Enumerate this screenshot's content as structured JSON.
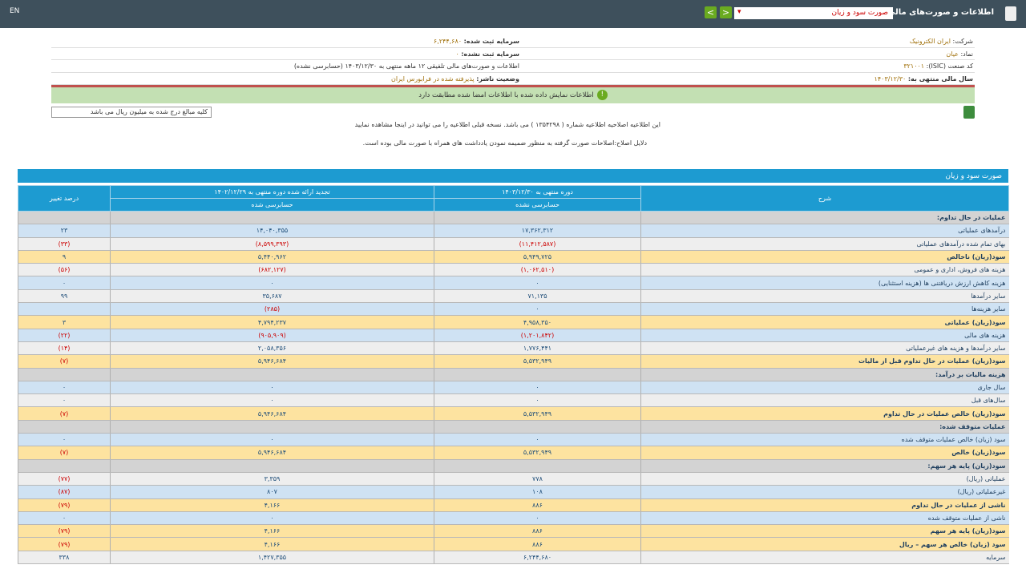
{
  "topbar": {
    "lang": "EN",
    "title": "اطلاعات و صورت‌های مالی تلفیقی",
    "select": "صورت سود و زیان",
    "prev": "<",
    "next": ">"
  },
  "info": {
    "company_label": "شرکت:",
    "company": "ایران الکترونیک",
    "symbol_label": "نماد:",
    "symbol": "عیان",
    "isic_label": "کد صنعت (ISIC):",
    "isic": "۳۲۱۰۰۱",
    "fy_label": "سال مالی منتهی به:",
    "fy": "۱۴۰۳/۱۲/۳۰",
    "cap_label": "سرمایه ثبت شده:",
    "cap": "۶,۲۴۴,۶۸۰",
    "uncap_label": "سرمایه ثبت نشده:",
    "uncap": "۰",
    "report": "اطلاعات و صورت‌های مالی تلفیقی ۱۲ ماهه منتهی به ۱۴۰۳/۱۲/۳۰ (حسابرسی نشده)",
    "status_label": "وضعیت ناشر:",
    "status": "پذیرفته شده در فرابورس ایران",
    "match": "اطلاعات نمایش داده شده با اطلاعات امضا شده مطابقت دارد"
  },
  "unit": "کلیه مبالغ درج شده به میلیون ریال می باشد",
  "notice1": "این اطلاعیه اصلاحیه اطلاعیه شماره ( ۱۳۵۴۲۹۸ ) می باشد. نسخه قبلی اطلاعیه را می توانید در اینجا مشاهده نمایید",
  "notice2": "دلایل اصلاح:اصلاحات صورت گرفته به منظور ضمیمه نمودن یادداشت های همراه با صورت مالی بوده است.",
  "table": {
    "caption": "صورت سود و زیان",
    "h_desc": "شرح",
    "h_cur": "دوره منتهی به ۱۴۰۳/۱۲/۳۰",
    "h_cur_sub": "حسابرسی نشده",
    "h_prev": "تجدید ارائه شده دوره منتهی به ۱۴۰۲/۱۲/۲۹",
    "h_prev_sub": "حسابرسی شده",
    "h_pct": "درصد تغییر",
    "rows": [
      {
        "t": "sec",
        "label": "عملیات در حال تداوم:",
        "cur": "",
        "prev": "",
        "pct": ""
      },
      {
        "t": "blue",
        "label": "درآمدهای عملیاتی",
        "cur": "۱۷,۳۶۲,۳۱۲",
        "prev": "۱۴,۰۴۰,۳۵۵",
        "pct": "۲۳"
      },
      {
        "t": "light",
        "label": "بهای تمام شده درآمدهای عملیاتی",
        "cur": "(۱۱,۴۱۲,۵۸۷)",
        "prev": "(۸,۵۹۹,۳۹۳)",
        "pct": "(۳۳)"
      },
      {
        "t": "yel",
        "label": "سود(زیان) ناخالص",
        "cur": "۵,۹۴۹,۷۲۵",
        "prev": "۵,۴۴۰,۹۶۲",
        "pct": "۹"
      },
      {
        "t": "light",
        "label": "هزینه های فروش، اداری و عمومی",
        "cur": "(۱,۰۶۲,۵۱۰)",
        "prev": "(۶۸۲,۱۲۷)",
        "pct": "(۵۶)"
      },
      {
        "t": "blue",
        "label": "هزینه کاهش ارزش دریافتنی ها (هزینه استثنایی)",
        "cur": "۰",
        "prev": "۰",
        "pct": "۰"
      },
      {
        "t": "light",
        "label": "سایر درآمدها",
        "cur": "۷۱,۱۳۵",
        "prev": "۳۵,۶۸۷",
        "pct": "۹۹"
      },
      {
        "t": "blue",
        "label": "سایر هزینه‌ها",
        "cur": "۰",
        "prev": "(۲۸۵)",
        "pct": ""
      },
      {
        "t": "yel",
        "label": "سود(زیان) عملیاتی",
        "cur": "۴,۹۵۸,۳۵۰",
        "prev": "۴,۷۹۴,۲۳۷",
        "pct": "۳"
      },
      {
        "t": "blue",
        "label": "هزینه های مالی",
        "cur": "(۱,۲۰۱,۸۴۲)",
        "prev": "(۹۰۵,۹۰۹)",
        "pct": "(۲۲)"
      },
      {
        "t": "light",
        "label": "سایر درآمدها و هزینه های غیرعملیاتی",
        "cur": "۱,۷۷۶,۴۴۱",
        "prev": "۲,۰۵۸,۳۵۶",
        "pct": "(۱۴)"
      },
      {
        "t": "yel",
        "label": "سود(زیان) عملیات در حال تداوم قبل از مالیات",
        "cur": "۵,۵۳۲,۹۴۹",
        "prev": "۵,۹۴۶,۶۸۴",
        "pct": "(۷)"
      },
      {
        "t": "sec",
        "label": "هزینه مالیات بر درآمد:",
        "cur": "",
        "prev": "",
        "pct": ""
      },
      {
        "t": "blue",
        "label": "سال جاری",
        "cur": "۰",
        "prev": "۰",
        "pct": "۰"
      },
      {
        "t": "light",
        "label": "سال‌های قبل",
        "cur": "۰",
        "prev": "۰",
        "pct": "۰"
      },
      {
        "t": "yel",
        "label": "سود(زیان) خالص عملیات در حال تداوم",
        "cur": "۵,۵۳۲,۹۴۹",
        "prev": "۵,۹۴۶,۶۸۴",
        "pct": "(۷)"
      },
      {
        "t": "sec",
        "label": "عملیات متوقف شده:",
        "cur": "",
        "prev": "",
        "pct": ""
      },
      {
        "t": "blue",
        "label": "سود (زیان) خالص عملیات متوقف شده",
        "cur": "۰",
        "prev": "۰",
        "pct": "۰"
      },
      {
        "t": "yel",
        "label": "سود(زیان) خالص",
        "cur": "۵,۵۳۲,۹۴۹",
        "prev": "۵,۹۴۶,۶۸۴",
        "pct": "(۷)"
      },
      {
        "t": "sec",
        "label": "سود(زیان) پایه هر سهم:",
        "cur": "",
        "prev": "",
        "pct": ""
      },
      {
        "t": "light",
        "label": "عملیاتی (ریال)",
        "cur": "۷۷۸",
        "prev": "۳,۳۵۹",
        "pct": "(۷۷)"
      },
      {
        "t": "blue",
        "label": "غیرعملیاتی (ریال)",
        "cur": "۱۰۸",
        "prev": "۸۰۷",
        "pct": "(۸۷)"
      },
      {
        "t": "yel",
        "label": "ناشی از عملیات در حال تداوم",
        "cur": "۸۸۶",
        "prev": "۴,۱۶۶",
        "pct": "(۷۹)"
      },
      {
        "t": "blue",
        "label": "ناشی از عملیات متوقف شده",
        "cur": "۰",
        "prev": "۰",
        "pct": "۰"
      },
      {
        "t": "yel",
        "label": "سود(زیان) پایه هر سهم",
        "cur": "۸۸۶",
        "prev": "۴,۱۶۶",
        "pct": "(۷۹)"
      },
      {
        "t": "yel",
        "label": "سود (زیان) خالص هر سهم – ریال",
        "cur": "۸۸۶",
        "prev": "۴,۱۶۶",
        "pct": "(۷۹)"
      },
      {
        "t": "light",
        "label": "سرمایه",
        "cur": "۶,۲۴۴,۶۸۰",
        "prev": "۱,۴۲۷,۳۵۵",
        "pct": "۳۳۸"
      }
    ]
  }
}
